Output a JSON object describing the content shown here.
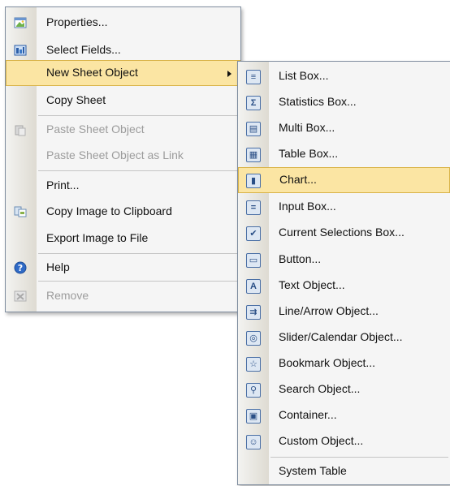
{
  "main_menu": {
    "items": [
      {
        "label": "Properties...",
        "icon": "properties-icon",
        "state": "normal"
      },
      {
        "label": "Select Fields...",
        "icon": "select-fields-icon",
        "state": "normal"
      },
      {
        "label": "New Sheet Object",
        "icon": "",
        "state": "highlighted",
        "submenu": true
      },
      {
        "label": "Copy Sheet",
        "icon": "",
        "state": "normal"
      },
      {
        "label": "Paste Sheet Object",
        "icon": "paste-icon",
        "state": "disabled"
      },
      {
        "label": "Paste Sheet Object as Link",
        "icon": "",
        "state": "disabled"
      },
      {
        "label": "Print...",
        "icon": "",
        "state": "normal"
      },
      {
        "label": "Copy Image to Clipboard",
        "icon": "copy-image-icon",
        "state": "normal"
      },
      {
        "label": "Export Image to File",
        "icon": "",
        "state": "normal"
      },
      {
        "label": "Help",
        "icon": "help-icon",
        "state": "normal"
      },
      {
        "label": "Remove",
        "icon": "remove-icon",
        "state": "disabled"
      }
    ]
  },
  "sub_menu": {
    "items": [
      {
        "label": "List Box...",
        "icon": "list-box-icon",
        "glyph": "≡"
      },
      {
        "label": "Statistics Box...",
        "icon": "statistics-box-icon",
        "glyph": "Σ"
      },
      {
        "label": "Multi Box...",
        "icon": "multi-box-icon",
        "glyph": "▤"
      },
      {
        "label": "Table Box...",
        "icon": "table-box-icon",
        "glyph": "▦"
      },
      {
        "label": "Chart...",
        "icon": "chart-icon",
        "glyph": "▮",
        "state": "highlighted"
      },
      {
        "label": "Input Box...",
        "icon": "input-box-icon",
        "glyph": "="
      },
      {
        "label": "Current Selections Box...",
        "icon": "current-selections-box-icon",
        "glyph": "✔"
      },
      {
        "label": "Button...",
        "icon": "button-icon",
        "glyph": "▭"
      },
      {
        "label": "Text Object...",
        "icon": "text-object-icon",
        "glyph": "A"
      },
      {
        "label": "Line/Arrow Object...",
        "icon": "line-arrow-object-icon",
        "glyph": "⇉"
      },
      {
        "label": "Slider/Calendar Object...",
        "icon": "slider-calendar-object-icon",
        "glyph": "◎"
      },
      {
        "label": "Bookmark Object...",
        "icon": "bookmark-object-icon",
        "glyph": "☆"
      },
      {
        "label": "Search Object...",
        "icon": "search-object-icon",
        "glyph": "⚲"
      },
      {
        "label": "Container...",
        "icon": "container-icon",
        "glyph": "▣"
      },
      {
        "label": "Custom Object...",
        "icon": "custom-object-icon",
        "glyph": "☺"
      },
      {
        "label": "System Table",
        "icon": "",
        "glyph": ""
      }
    ]
  }
}
